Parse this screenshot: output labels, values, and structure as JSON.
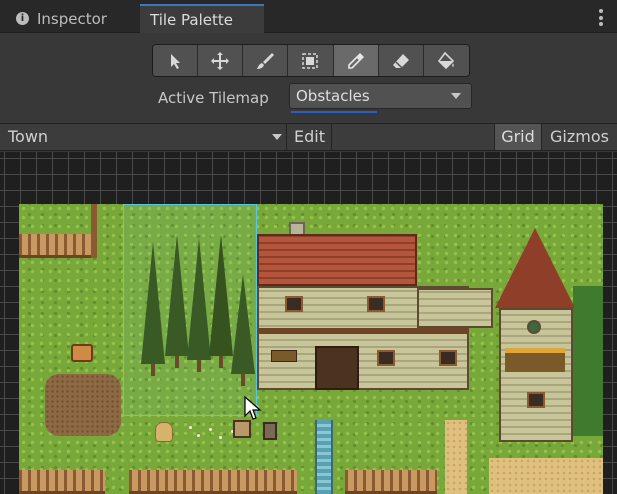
{
  "tabs": [
    {
      "label": "Inspector",
      "icon": "info-icon",
      "active": false
    },
    {
      "label": "Tile Palette",
      "active": true
    }
  ],
  "toolbar": {
    "tools": [
      {
        "name": "select-tool",
        "icon": "arrow-pointer-icon",
        "active": false
      },
      {
        "name": "move-tool",
        "icon": "move-arrows-icon",
        "active": false
      },
      {
        "name": "paint-tool",
        "icon": "paintbrush-icon",
        "active": false
      },
      {
        "name": "box-fill-tool",
        "icon": "box-fill-icon",
        "active": false
      },
      {
        "name": "picker-tool",
        "icon": "eyedropper-icon",
        "active": true
      },
      {
        "name": "erase-tool",
        "icon": "eraser-icon",
        "active": false
      },
      {
        "name": "flood-fill-tool",
        "icon": "paint-bucket-icon",
        "active": false
      }
    ]
  },
  "active_tilemap": {
    "label": "Active Tilemap",
    "value": "Obstacles"
  },
  "palette_bar": {
    "palette_name": "Town",
    "edit_label": "Edit",
    "grid_label": "Grid",
    "gizmos_label": "Gizmos"
  },
  "colors": {
    "accent": "#3a79bb",
    "focus": "#2c5cc5",
    "selection": "#59c7e0",
    "grass": "#79a83a"
  }
}
